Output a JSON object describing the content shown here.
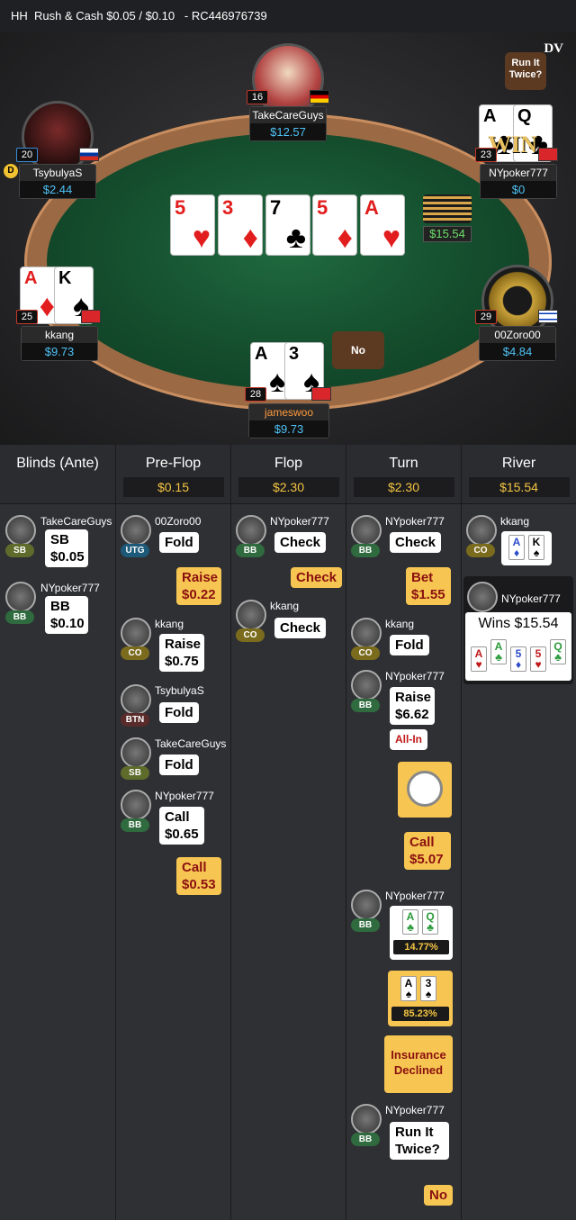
{
  "header": {
    "title": "HH  Rush & Cash $0.05 / $0.10   - RC446976739"
  },
  "table": {
    "logo": "DV",
    "run_it_twice_bubble": "Run It Twice?",
    "no_bubble": "No",
    "pot": "$15.54",
    "board": [
      {
        "rank": "5",
        "suit": "♥",
        "color": "red"
      },
      {
        "rank": "3",
        "suit": "♦",
        "color": "red"
      },
      {
        "rank": "7",
        "suit": "♣",
        "color": "blk"
      },
      {
        "rank": "5",
        "suit": "♦",
        "color": "red"
      },
      {
        "rank": "A",
        "suit": "♥",
        "color": "red"
      }
    ],
    "seats": {
      "top": {
        "name": "TakeCareGuys",
        "stack": "$12.57",
        "level": "16"
      },
      "left_top": {
        "name": "TsybulyaS",
        "stack": "$2.44",
        "level": "20",
        "dealer": "D"
      },
      "right_top": {
        "name": "NYpoker777",
        "stack": "$0",
        "level": "23",
        "win": "WIN",
        "cards": [
          {
            "rank": "A",
            "suit": "♣",
            "color": "blk"
          },
          {
            "rank": "Q",
            "suit": "♣",
            "color": "blk"
          }
        ]
      },
      "left_bottom": {
        "name": "kkang",
        "stack": "$9.73",
        "level": "25",
        "cards": [
          {
            "rank": "A",
            "suit": "♦",
            "color": "red"
          },
          {
            "rank": "K",
            "suit": "♠",
            "color": "blk"
          }
        ]
      },
      "right_bottom": {
        "name": "00Zoro00",
        "stack": "$4.84",
        "level": "29"
      },
      "bottom": {
        "name": "jameswoo",
        "stack": "$9.73",
        "level": "28",
        "cards": [
          {
            "rank": "A",
            "suit": "♠",
            "color": "blk"
          },
          {
            "rank": "3",
            "suit": "♠",
            "color": "blk"
          }
        ]
      }
    }
  },
  "columns": [
    {
      "title": "Blinds (Ante)",
      "pot": ""
    },
    {
      "title": "Pre-Flop",
      "pot": "$0.15"
    },
    {
      "title": "Flop",
      "pot": "$2.30"
    },
    {
      "title": "Turn",
      "pot": "$2.30"
    },
    {
      "title": "River",
      "pot": "$15.54"
    }
  ],
  "blinds": [
    {
      "name": "TakeCareGuys",
      "pos": "SB",
      "action": "SB",
      "amount": "$0.05"
    },
    {
      "name": "NYpoker777",
      "pos": "BB",
      "action": "BB",
      "amount": "$0.10"
    }
  ],
  "preflop": {
    "p1": {
      "name": "00Zoro00",
      "pos": "UTG",
      "action": "Fold"
    },
    "hero_raise": {
      "action": "Raise",
      "amount": "$0.22"
    },
    "p2": {
      "name": "kkang",
      "pos": "CO",
      "action": "Raise",
      "amount": "$0.75"
    },
    "p3": {
      "name": "TsybulyaS",
      "pos": "BTN",
      "action": "Fold"
    },
    "p4": {
      "name": "TakeCareGuys",
      "pos": "SB",
      "action": "Fold"
    },
    "p5": {
      "name": "NYpoker777",
      "pos": "BB",
      "action": "Call",
      "amount": "$0.65"
    },
    "hero_call": {
      "action": "Call",
      "amount": "$0.53"
    }
  },
  "flop": {
    "p1": {
      "name": "NYpoker777",
      "pos": "BB",
      "action": "Check"
    },
    "hero": {
      "action": "Check"
    },
    "p2": {
      "name": "kkang",
      "pos": "CO",
      "action": "Check"
    }
  },
  "turn": {
    "p1": {
      "name": "NYpoker777",
      "pos": "BB",
      "action": "Check"
    },
    "hero_bet": {
      "action": "Bet",
      "amount": "$1.55"
    },
    "p2": {
      "name": "kkang",
      "pos": "CO",
      "action": "Fold"
    },
    "p3": {
      "name": "NYpoker777",
      "pos": "BB",
      "action": "Raise",
      "amount": "$6.62",
      "allin": "All-In"
    },
    "hero_call": {
      "action": "Call",
      "amount": "$5.07"
    },
    "p4": {
      "name": "NYpoker777",
      "pos": "BB",
      "cards": [
        {
          "rank": "A",
          "suit": "♣"
        },
        {
          "rank": "Q",
          "suit": "♣"
        }
      ],
      "equity": "14.77%"
    },
    "hero_cards": {
      "cards": [
        {
          "rank": "A",
          "suit": "♠"
        },
        {
          "rank": "3",
          "suit": "♠"
        }
      ],
      "equity": "85.23%"
    },
    "insurance": {
      "line1": "Insurance",
      "line2": "Declined"
    },
    "p5": {
      "name": "NYpoker777",
      "pos": "BB",
      "action1": "Run It",
      "action2": "Twice?"
    },
    "hero_no": {
      "action": "No"
    }
  },
  "river": {
    "p1": {
      "name": "kkang",
      "pos": "CO",
      "cards": [
        {
          "rank": "A",
          "suit": "♦"
        },
        {
          "rank": "K",
          "suit": "♠"
        }
      ]
    },
    "winner": {
      "name": "NYpoker777",
      "wins": "Wins $15.54",
      "cards": [
        {
          "rank": "A",
          "suit": "♥"
        },
        {
          "rank": "A",
          "suit": "♣"
        },
        {
          "rank": "5",
          "suit": "♦"
        },
        {
          "rank": "5",
          "suit": "♥"
        },
        {
          "rank": "Q",
          "suit": "♣"
        }
      ]
    }
  },
  "colors": {
    "sb": "#5d6b2b",
    "bb": "#2f6b3e",
    "utg": "#1d5a7a",
    "co": "#7a6b1d",
    "btn": "#5a2b2b",
    "accent": "#f7c652"
  }
}
